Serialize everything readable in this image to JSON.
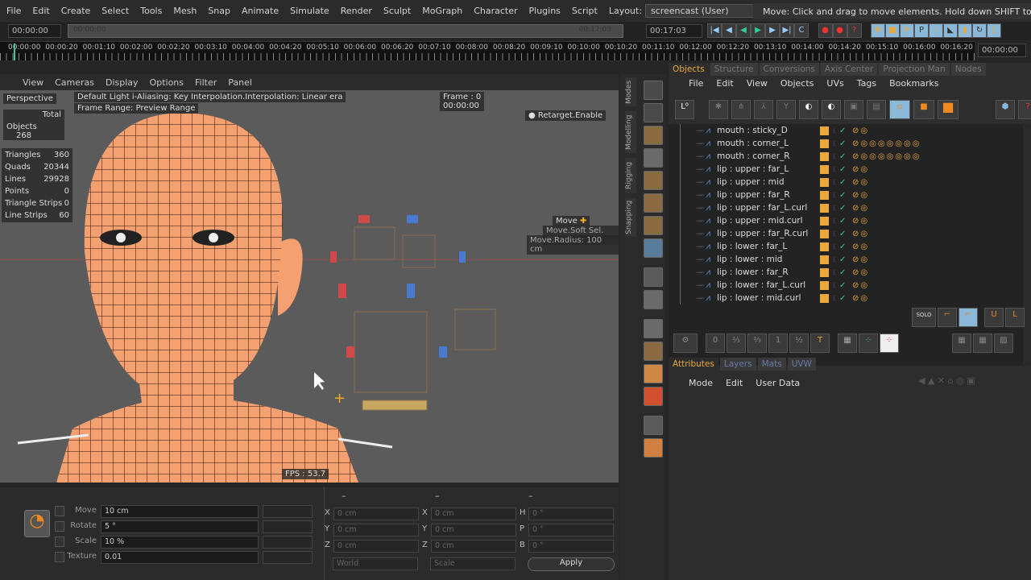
{
  "menu": [
    "File",
    "Edit",
    "Create",
    "Select",
    "Tools",
    "Mesh",
    "Snap",
    "Animate",
    "Simulate",
    "Render",
    "Sculpt",
    "MoGraph",
    "Character",
    "Plugins",
    "Script"
  ],
  "layout_label": "Layout:",
  "layout_value": "screencast (User)",
  "status": "Move: Click and drag to move elements. Hold down SHIFT to quantize",
  "time": {
    "start": "00:00:00",
    "preview_start": "00:00:00",
    "preview_end": "00:17:03",
    "end": "00:17:03",
    "current": "00:00:00"
  },
  "ruler": [
    "00:00:00",
    "00:00:20",
    "00:01:10",
    "00:02:00",
    "00:02:20",
    "00:03:10",
    "00:04:00",
    "00:04:20",
    "00:05:10",
    "00:06:00",
    "00:06:20",
    "00:07:10",
    "00:08:00",
    "00:08:20",
    "00:09:10",
    "00:10:00",
    "00:10:20",
    "00:11:10",
    "00:12:00",
    "00:12:20",
    "00:13:10",
    "00:14:00",
    "00:14:20",
    "00:15:10",
    "00:16:00",
    "00:16:20"
  ],
  "viewport": {
    "menu": [
      "View",
      "Cameras",
      "Display",
      "Options",
      "Filter",
      "Panel"
    ],
    "camera": "Perspective",
    "info_line1": "Default Light i-Aliasing: Key Interpolation.Interpolation: Linear era",
    "info_line2": "Frame Range: Preview Range",
    "frame_label": "Frame : 0",
    "frame_time": "00:00:00",
    "retarget": "Retarget.Enable",
    "total_label": "Total",
    "objects_label": "Objects",
    "objects": "268",
    "stats": [
      [
        "Triangles",
        "360"
      ],
      [
        "Quads",
        "20344"
      ],
      [
        "Lines",
        "29928"
      ],
      [
        "Points",
        "0"
      ],
      [
        "Triangle Strips",
        "0"
      ],
      [
        "Line Strips",
        "60"
      ]
    ],
    "move": "Move",
    "soft_sel": "Move.Soft Sel. ON",
    "radius": "Move.Radius:  100 cm",
    "fps": "FPS : 53.7"
  },
  "side_tabs": [
    "Modes",
    "Modelling",
    "Rigging",
    "Snapping"
  ],
  "om": {
    "tabs": [
      "Objects",
      "Structure",
      "Conversions",
      "Axis Center",
      "Projection Man",
      "Nodes"
    ],
    "menu": [
      "File",
      "Edit",
      "View",
      "Objects",
      "UVs",
      "Tags",
      "Bookmarks"
    ],
    "rows": [
      [
        "mouth : sticky_D",
        1
      ],
      [
        "mouth : corner_L",
        7
      ],
      [
        "mouth : corner_R",
        7
      ],
      [
        "lip : upper : far_L",
        1
      ],
      [
        "lip : upper : mid",
        1
      ],
      [
        "lip : upper : far_R",
        1
      ],
      [
        "lip : upper : far_L.curl",
        1
      ],
      [
        "lip : upper : mid.curl",
        1
      ],
      [
        "lip : upper : far_R.curl",
        1
      ],
      [
        "lip : lower : far_L",
        1
      ],
      [
        "lip : lower : mid",
        1
      ],
      [
        "lip : lower : far_R",
        1
      ],
      [
        "lip : lower : far_L.curl",
        1
      ],
      [
        "lip : lower : mid.curl",
        1
      ]
    ]
  },
  "solo": "SOLO",
  "attr": {
    "tabs": [
      "Attributes",
      "Layers",
      "Mats",
      "UVW"
    ],
    "menu": [
      "Mode",
      "Edit",
      "User Data"
    ]
  },
  "tool": {
    "rows": [
      [
        "Move",
        "10 cm"
      ],
      [
        "Rotate",
        "5 °"
      ],
      [
        "Scale",
        "10 %"
      ],
      [
        "Texture",
        "0.01"
      ]
    ]
  },
  "coords": {
    "headers": [
      "–",
      "–",
      "–"
    ],
    "pos": [
      [
        "X",
        "0 cm"
      ],
      [
        "Y",
        "0 cm"
      ],
      [
        "Z",
        "0 cm"
      ]
    ],
    "size": [
      [
        "X",
        "0 cm"
      ],
      [
        "Y",
        "0 cm"
      ],
      [
        "Z",
        "0 cm"
      ]
    ],
    "rot": [
      [
        "H",
        "0 °"
      ],
      [
        "P",
        "0 °"
      ],
      [
        "B",
        "0 °"
      ]
    ],
    "space": "World",
    "mode": "Scale",
    "apply": "Apply"
  },
  "colors": {
    "accent": "#e8a93a",
    "mesh": "#f4a070",
    "viewport": "#5b5b5b"
  }
}
